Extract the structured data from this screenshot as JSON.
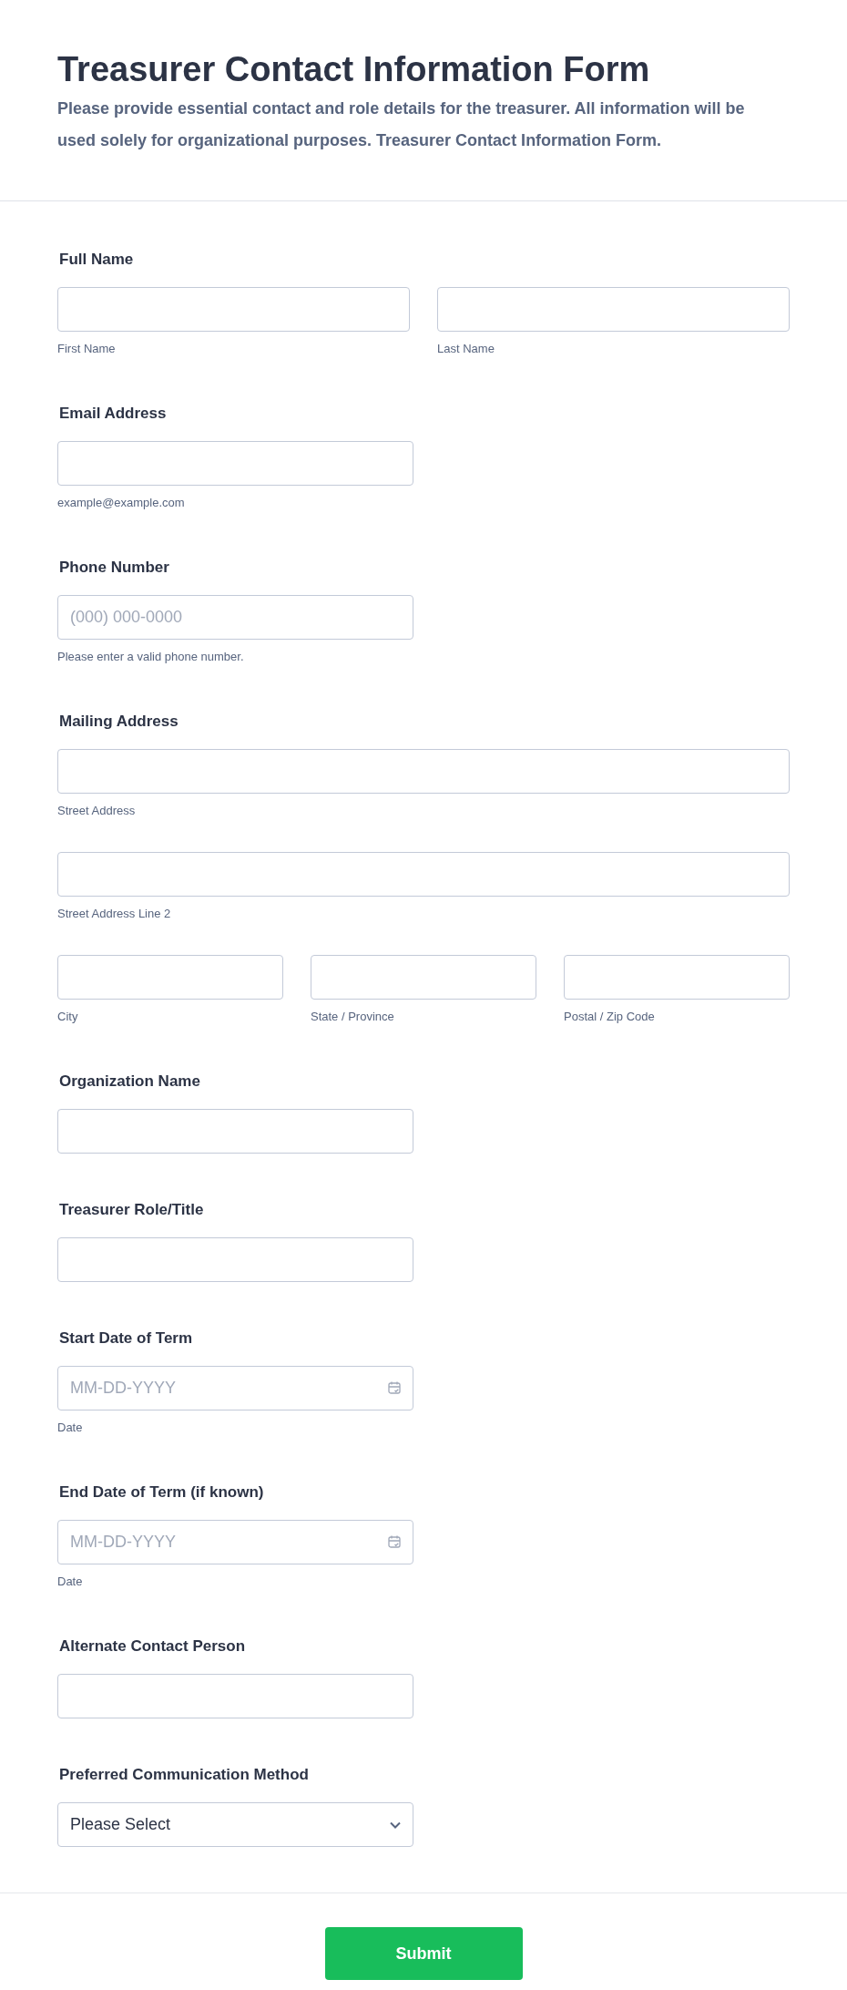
{
  "header": {
    "title": "Treasurer Contact Information Form",
    "description": "Please provide essential contact and role details for the treasurer. All information will be used solely for organizational purposes. Treasurer Contact Information Form."
  },
  "fields": [
    {
      "kind": "name",
      "label": "Full Name",
      "inputs": [
        {
          "sublabel": "First Name"
        },
        {
          "sublabel": "Last Name"
        }
      ]
    },
    {
      "kind": "short",
      "label": "Email Address",
      "inputs": [
        {
          "sublabel": "example@example.com"
        }
      ]
    },
    {
      "kind": "short",
      "label": "Phone Number",
      "inputs": [
        {
          "placeholder": "(000) 000-0000",
          "sublabel": "Please enter a valid phone number."
        }
      ]
    },
    {
      "kind": "address",
      "label": "Mailing Address",
      "inputs": [
        {
          "sublabel": "Street Address"
        },
        {
          "sublabel": "Street Address Line 2"
        },
        {
          "sublabel": "City"
        },
        {
          "sublabel": "State / Province"
        },
        {
          "sublabel": "Postal / Zip Code"
        }
      ]
    },
    {
      "kind": "short",
      "label": "Organization Name"
    },
    {
      "kind": "short",
      "label": "Treasurer Role/Title"
    },
    {
      "kind": "date",
      "label": "Start Date of Term",
      "inputs": [
        {
          "placeholder": "MM-DD-YYYY",
          "sublabel": "Date"
        }
      ]
    },
    {
      "kind": "date",
      "label": "End Date of Term (if known)",
      "inputs": [
        {
          "placeholder": "MM-DD-YYYY",
          "sublabel": "Date"
        }
      ]
    },
    {
      "kind": "short",
      "label": "Alternate Contact Person"
    },
    {
      "kind": "select",
      "label": "Preferred Communication Method",
      "inputs": [
        {
          "value": "Please Select"
        }
      ]
    }
  ],
  "submit": {
    "label": "Submit"
  }
}
